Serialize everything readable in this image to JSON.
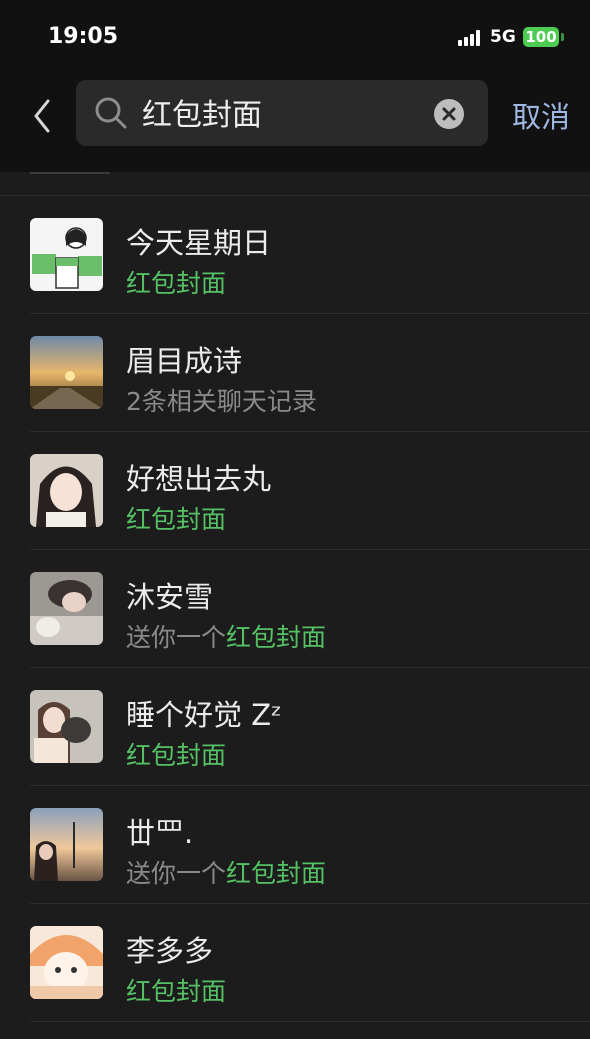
{
  "status_bar": {
    "time": "19:05",
    "network": "5G",
    "battery": "100"
  },
  "header": {
    "search_value": "红包封面",
    "cancel_label": "取消"
  },
  "results": [
    {
      "name": "今天星期日",
      "prefix": "",
      "highlight": "红包封面",
      "avatar": "cartoon-girl-mahjong-avatar"
    },
    {
      "name": "眉目成诗",
      "prefix": "2条相关聊天记录",
      "highlight": "",
      "avatar": "sunset-landscape-avatar"
    },
    {
      "name": "好想出去丸",
      "prefix": "",
      "highlight": "红包封面",
      "avatar": "girl-photo-avatar"
    },
    {
      "name": "沐安雪",
      "prefix": "送你一个",
      "highlight": "红包封面",
      "avatar": "sleeping-girl-avatar"
    },
    {
      "name": "睡个好觉 Zᶻ",
      "prefix": "",
      "highlight": "红包封面",
      "avatar": "girl-with-cat-avatar"
    },
    {
      "name": "丗罒.",
      "prefix": "送你一个",
      "highlight": "红包封面",
      "avatar": "sunset-girl-avatar"
    },
    {
      "name": "李多多",
      "prefix": "",
      "highlight": "红包封面",
      "avatar": "anime-girl-avatar"
    }
  ],
  "colors": {
    "highlight": "#55c165",
    "cancel": "#9fb7e2",
    "background": "#1c1c1c"
  }
}
